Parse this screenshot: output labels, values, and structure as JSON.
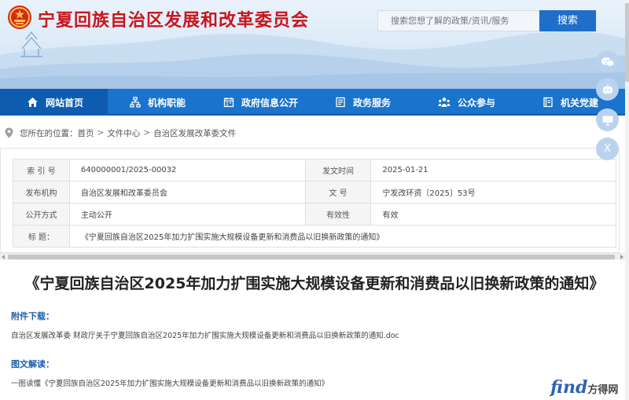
{
  "header": {
    "site_title": "宁夏回族自治区发展和改革委员会",
    "search_placeholder": "搜索您想了解的政策/资讯/服务",
    "search_button": "搜索"
  },
  "nav": {
    "items": [
      {
        "label": "网站首页",
        "icon": "home-icon"
      },
      {
        "label": "机构职能",
        "icon": "org-chart-icon"
      },
      {
        "label": "政府信息公开",
        "icon": "calendar-icon"
      },
      {
        "label": "政务服务",
        "icon": "document-icon"
      },
      {
        "label": "公众参与",
        "icon": "people-icon"
      },
      {
        "label": "机关党建",
        "icon": "book-icon"
      }
    ],
    "active_index": 0
  },
  "breadcrumb": {
    "prefix": "您所在的位置：",
    "items": [
      "首页",
      "文件中心",
      "自治区发展改革委文件"
    ],
    "separator": ">"
  },
  "meta": {
    "index_label": "索 引 号",
    "index_value": "640000001/2025-00032",
    "date_label": "发文时间",
    "date_value": "2025-01-21",
    "issuer_label": "发布机构",
    "issuer_value": "自治区发展和改革委员会",
    "docno_label": "文 号",
    "docno_value": "宁发改环资〔2025〕53号",
    "disclosure_label": "公开方式",
    "disclosure_value": "主动公开",
    "validity_label": "有效性",
    "validity_value": "有效",
    "title_label": "标 题：",
    "title_value": "《宁夏回族自治区2025年加力扩围实施大规模设备更新和消费品以旧换新政策的通知》"
  },
  "article": {
    "title": "《宁夏回族自治区2025年加力扩围实施大规模设备更新和消费品以旧换新政策的通知》",
    "attachment_label": "附件下载：",
    "attachment_link": "自治区发展改革委 财政厅关于宁夏回族自治区2025年加力扩围实施大规模设备更新和消费品以旧换新政策的通知.doc",
    "interpret_label": "图文解读：",
    "interpret_link": "一图读懂《宁夏回族自治区2025年加力扩围实施大规模设备更新和消费品以旧换新政策的通知》"
  },
  "float_tools": {
    "close_label": "X",
    "icons": [
      "wechat-icon",
      "robot-icon",
      "monitor-icon"
    ]
  },
  "watermark": {
    "brand": "find",
    "cn": "方得网"
  },
  "colors": {
    "brand_red": "#c8161d",
    "nav_blue": "#1a73cc",
    "nav_active": "#0d5cb0",
    "button_blue": "#1f6fc8",
    "section_blue": "#1f5fae"
  }
}
